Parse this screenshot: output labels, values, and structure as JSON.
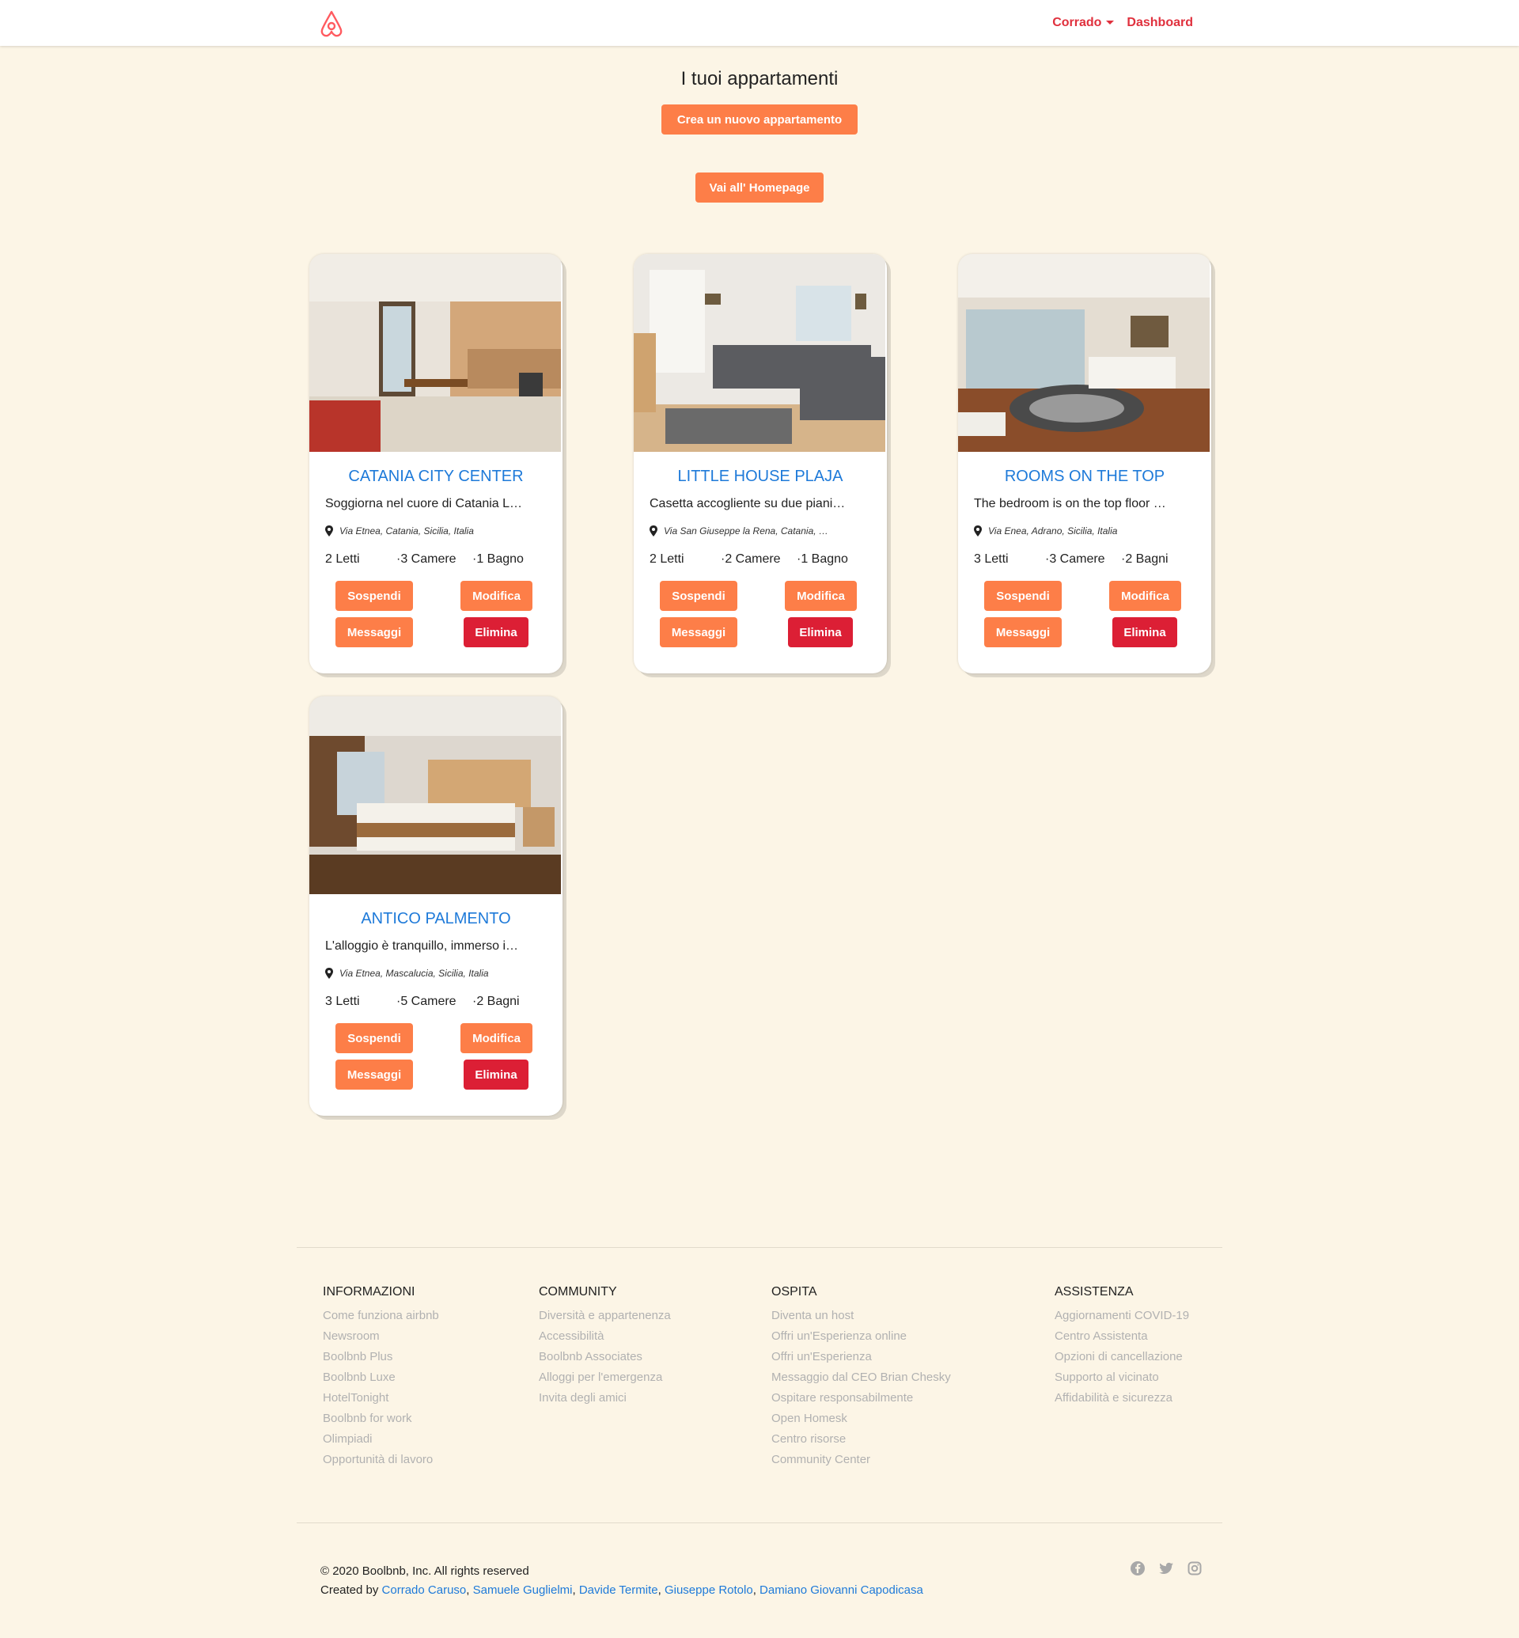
{
  "navbar": {
    "brand_color": "#FF5A5F",
    "user_label": "Corrado",
    "dashboard_label": "Dashboard"
  },
  "header": {
    "title": "I tuoi appartamenti",
    "create_label": "Crea un nuovo appartamento",
    "home_label": "Vai all' Homepage"
  },
  "cards": [
    {
      "title": "CATANIA CITY CENTER",
      "desc": "Soggiorna nel cuore di Catania L…",
      "address": "Via Etnea, Catania, Sicilia, Italia",
      "beds": "2 Letti",
      "rooms": "·3 Camere",
      "baths": "·1 Bagno",
      "suspend": "Sospendi",
      "edit": "Modifica",
      "messages": "Messaggi",
      "delete": "Elimina"
    },
    {
      "title": "LITTLE HOUSE PLAJA",
      "desc": "Casetta accogliente su due piani…",
      "address": "Via San Giuseppe la Rena, Catania, …",
      "beds": "2 Letti",
      "rooms": "·2 Camere",
      "baths": "·1 Bagno",
      "suspend": "Sospendi",
      "edit": "Modifica",
      "messages": "Messaggi",
      "delete": "Elimina"
    },
    {
      "title": "ROOMS ON THE TOP",
      "desc": "The bedroom is on the top floor …",
      "address": "Via Enea, Adrano, Sicilia, Italia",
      "beds": "3 Letti",
      "rooms": "·3 Camere",
      "baths": "·2 Bagni",
      "suspend": "Sospendi",
      "edit": "Modifica",
      "messages": "Messaggi",
      "delete": "Elimina"
    },
    {
      "title": "ANTICO PALMENTO",
      "desc": "L'alloggio è tranquillo, immerso i…",
      "address": "Via Etnea, Mascalucia, Sicilia, Italia",
      "beds": "3 Letti",
      "rooms": "·5 Camere",
      "baths": "·2 Bagni",
      "suspend": "Sospendi",
      "edit": "Modifica",
      "messages": "Messaggi",
      "delete": "Elimina"
    }
  ],
  "footer": {
    "informazioni": {
      "title": "INFORMAZIONI",
      "links": [
        "Come funziona airbnb",
        "Newsroom",
        "Boolbnb Plus",
        "Boolbnb Luxe",
        "HotelTonight",
        "Boolbnb for work",
        "Olimpiadi",
        "Opportunità di lavoro"
      ]
    },
    "community": {
      "title": "COMMUNITY",
      "links": [
        "Diversità e appartenenza",
        "Accessibilità",
        "Boolbnb Associates",
        "Alloggi per l'emergenza",
        "Invita degli amici"
      ]
    },
    "ospita": {
      "title": "OSPITA",
      "links": [
        "Diventa un host",
        "Offri un'Esperienza online",
        "Offri un'Esperienza",
        "Messaggio dal CEO Brian Chesky",
        "Ospitare responsabilmente",
        "Open Homesk",
        "Centro risorse",
        "Community Center"
      ]
    },
    "assistenza": {
      "title": "ASSISTENZA",
      "links": [
        "Aggiornamenti COVID-19",
        "Centro Assistenta",
        "Opzioni di cancellazione",
        "Supporto al vicinato",
        "Affidabilità e sicurezza"
      ]
    },
    "copyright": "© 2020 Boolbnb, Inc. All rights reserved",
    "created_by": "Created by",
    "authors": [
      "Corrado Caruso",
      "Samuele Guglielmi",
      "Davide Termite",
      "Giuseppe Rotolo",
      "Damiano Giovanni Capodicasa"
    ],
    "socials": [
      "facebook-icon",
      "twitter-icon",
      "instagram-icon"
    ]
  },
  "colors": {
    "background": "#fcf5e6",
    "accent_orange": "#fd7e48",
    "danger_red": "#dc1f35",
    "title_blue": "#1e7ad9",
    "nav_red": "#e0303d"
  }
}
